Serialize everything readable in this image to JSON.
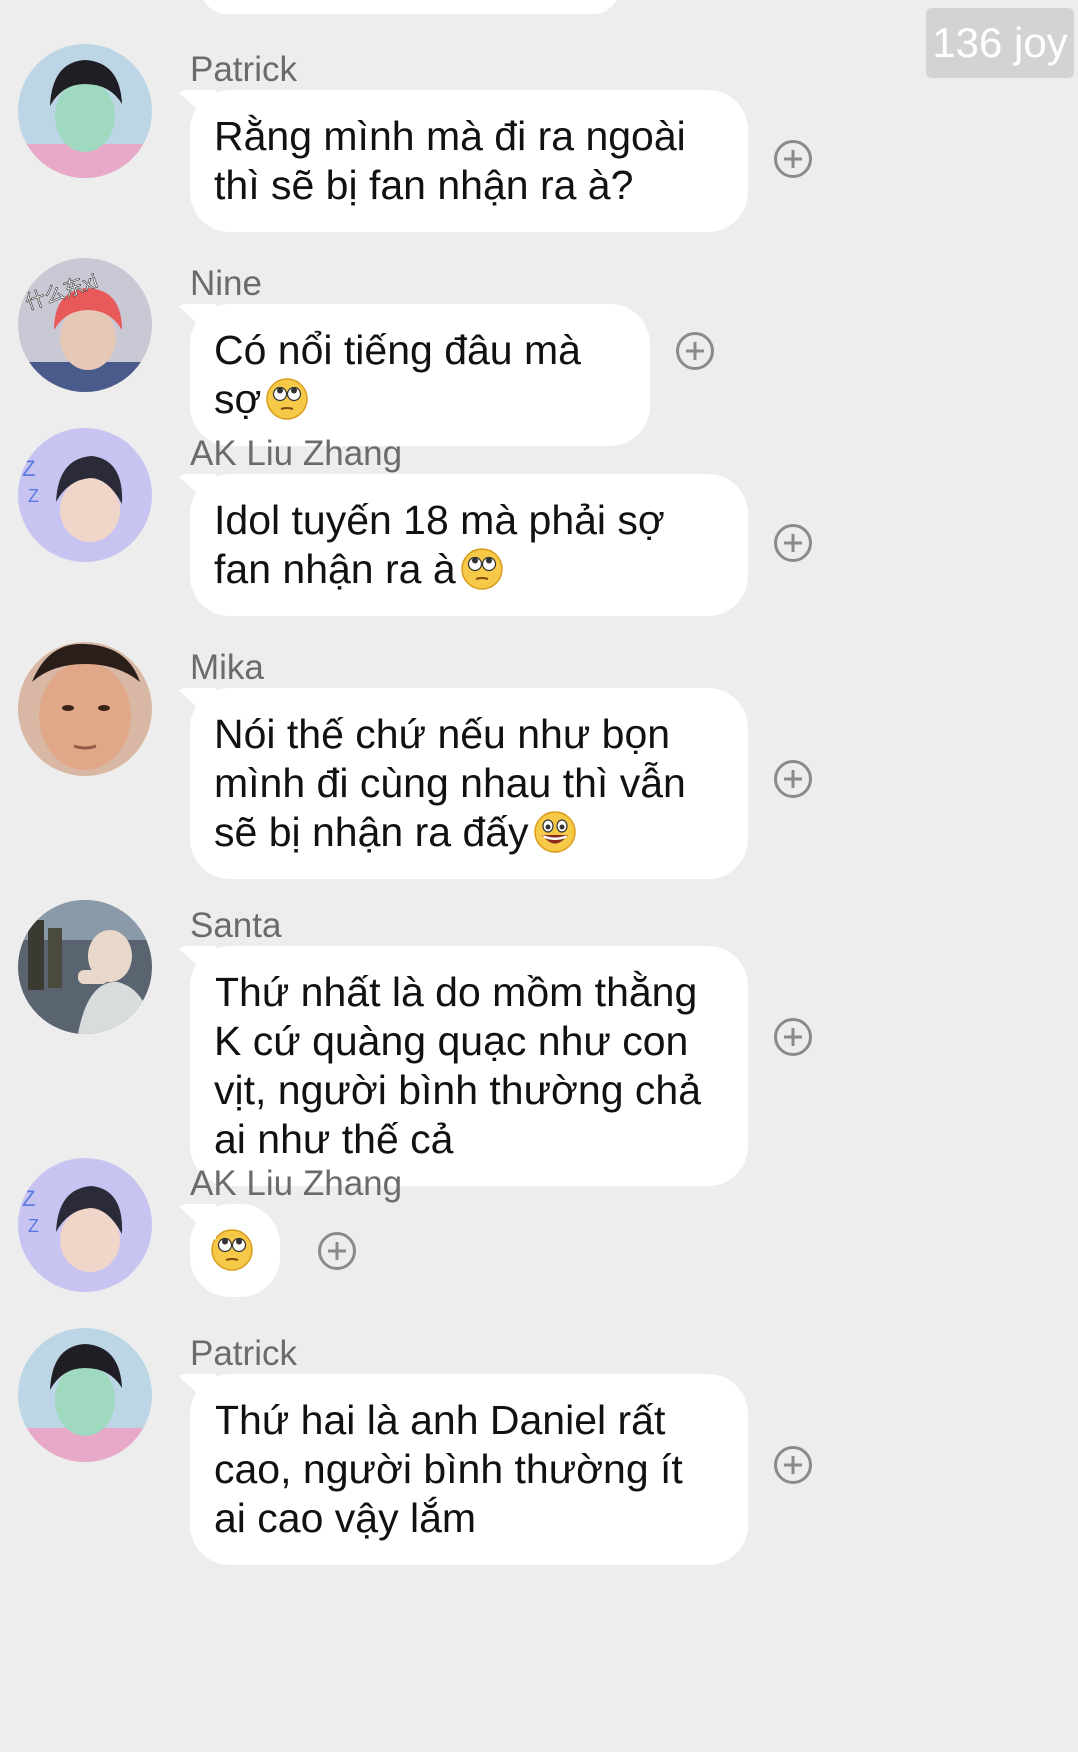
{
  "badge": "136 joy",
  "messages": [
    {
      "sender": "Patrick",
      "text": "Rằng mình mà đi ra ngoài thì sẽ bị fan nhận ra à?",
      "emoji": "",
      "avatar": "avatar-patrick"
    },
    {
      "sender": "Nine",
      "text": "Có nổi tiếng đâu mà sợ",
      "emoji": "eye-roll-emoji",
      "avatar": "avatar-nine",
      "avatar_caption": "什么东xi"
    },
    {
      "sender": "AK Liu Zhang",
      "text": "Idol tuyến 18 mà phải sợ fan nhận ra à",
      "emoji": "eye-roll-emoji",
      "avatar": "avatar-ak"
    },
    {
      "sender": "Mika",
      "text": "Nói thế chứ nếu như bọn mình đi cùng nhau thì vẫn sẽ bị nhận ra đấy",
      "emoji": "grin-emoji",
      "avatar": "avatar-mika"
    },
    {
      "sender": "Santa",
      "text": "Thứ nhất là do mồm thằng K cứ quàng quạc như con vịt, người bình thường chả ai như thế cả",
      "emoji": "",
      "avatar": "avatar-santa"
    },
    {
      "sender": "AK Liu Zhang",
      "text": "",
      "emoji": "eye-roll-emoji",
      "avatar": "avatar-ak"
    },
    {
      "sender": "Patrick",
      "text": "Thứ hai là anh Daniel rất cao, người bình thường ít ai cao vậy lắm",
      "emoji": "",
      "avatar": "avatar-patrick"
    }
  ],
  "colors": {
    "background": "#ededed",
    "bubble": "#ffffff",
    "sender": "#6b6b6b",
    "badge": "#d3d3d3"
  }
}
